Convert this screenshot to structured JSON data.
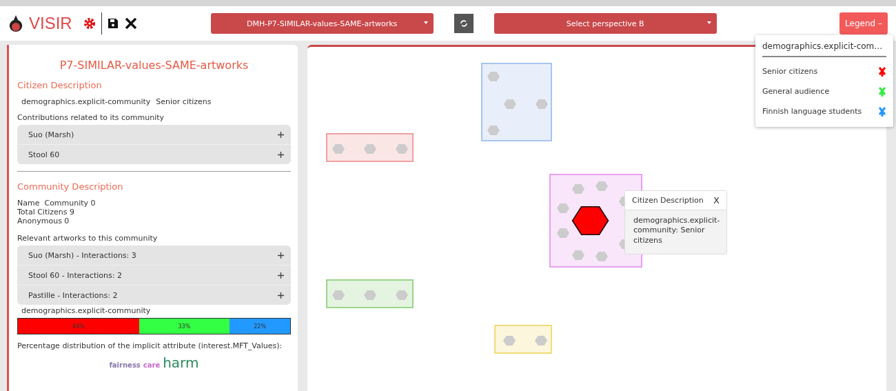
{
  "header": {
    "brand": "VISIR",
    "perspective_a": "DMH-P7-SIMILAR-values-SAME-artworks",
    "perspective_b": "Select perspective B",
    "legend_button": "Legend –"
  },
  "legend": {
    "title": "demographics.explicit-com…",
    "items": [
      {
        "label": "Senior citizens",
        "color": "#ff0000"
      },
      {
        "label": "General audience",
        "color": "#33ee44"
      },
      {
        "label": "Finnish language students",
        "color": "#2299ff"
      }
    ]
  },
  "panel": {
    "title": "P7-SIMILAR-values-SAME-artworks",
    "citizen_heading": "Citizen Description",
    "citizen_attribute": "demographics.explicit-community",
    "citizen_value": "Senior citizens",
    "contributions_label": "Contributions related to its community",
    "contributions": [
      {
        "label": "Suo (Marsh)",
        "expanded": false
      },
      {
        "label": "Stool 60",
        "expanded": false
      }
    ],
    "community_heading": "Community Description",
    "community_info": [
      "Name  Community 0",
      "Total Citizens 9",
      "Anonymous 0"
    ],
    "artworks_label": "Relevant artworks to this community",
    "artworks": [
      {
        "label": "Suo (Marsh) - Interactions: 3",
        "expanded": false
      },
      {
        "label": "Stool 60 - Interactions: 2",
        "expanded": false
      },
      {
        "label": "Pastille - Interactions: 2",
        "expanded": false
      }
    ],
    "distribution_label": "demographics.explicit-community",
    "distribution": [
      {
        "label": "44%",
        "color": "#ff0000"
      },
      {
        "label": "33%",
        "color": "#33ff44"
      },
      {
        "label": "22%",
        "color": "#2299ff"
      }
    ],
    "implicit_label": "Percentage distribution of the implicit attribute (interest.MFT_Values):",
    "word_cloud": [
      {
        "word": "fairness",
        "kind": "minor",
        "color": "#8877aa"
      },
      {
        "word": "care",
        "kind": "minor",
        "color": "#cc66cc"
      },
      {
        "word": "harm",
        "kind": "major",
        "color": "#2a8a5a"
      }
    ]
  },
  "graph": {
    "communities": [
      {
        "color": "#a8c4ee",
        "selected": false
      },
      {
        "color": "#f0a0a0",
        "selected": false
      },
      {
        "color": "#e8a0f0",
        "selected": true
      },
      {
        "color": "#9ad48a",
        "selected": false
      },
      {
        "color": "#f0dc7a",
        "selected": false
      }
    ],
    "tooltip": {
      "title": "Citizen Description",
      "close": "X",
      "body": "demographics.explicit-community: Senior citizens"
    }
  }
}
